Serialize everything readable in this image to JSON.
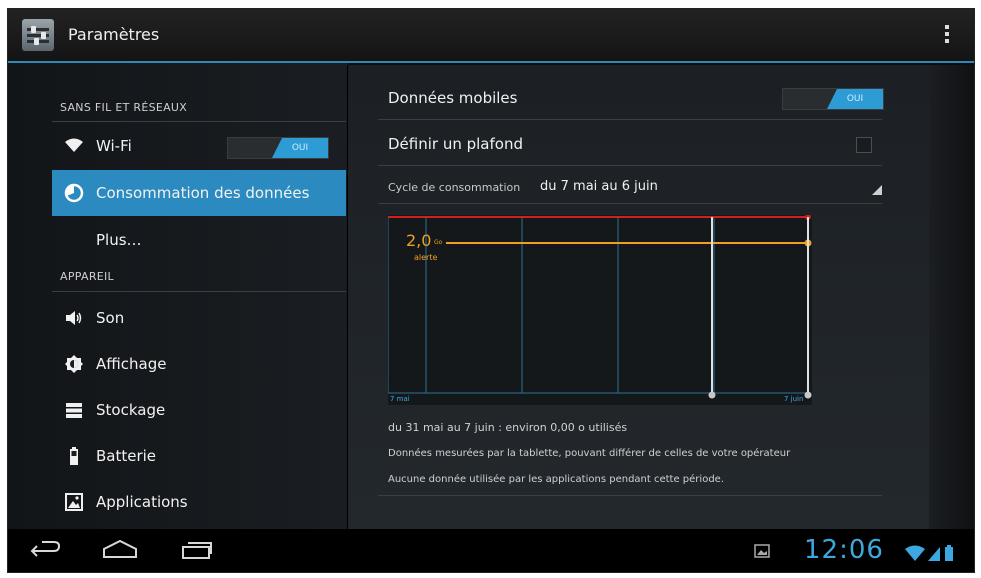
{
  "action_bar": {
    "title": "Paramètres",
    "icon": "settings-sliders-icon",
    "overflow_icon": "overflow-menu-icon"
  },
  "sidebar": {
    "section1": "SANS FIL ET RÉSEAUX",
    "section2": "APPAREIL",
    "items": [
      {
        "label": "Wi-Fi",
        "icon": "wifi-icon",
        "toggle": "OUI"
      },
      {
        "label": "Consommation des données",
        "icon": "data-usage-icon",
        "selected": true
      },
      {
        "label": "Plus…",
        "icon": ""
      },
      {
        "label": "Son",
        "icon": "speaker-icon"
      },
      {
        "label": "Affichage",
        "icon": "brightness-icon"
      },
      {
        "label": "Stockage",
        "icon": "storage-icon"
      },
      {
        "label": "Batterie",
        "icon": "battery-icon"
      },
      {
        "label": "Applications",
        "icon": "applications-icon"
      }
    ]
  },
  "detail": {
    "mobile_data_label": "Données mobiles",
    "mobile_data_toggle": "OUI",
    "limit_label": "Définir un plafond",
    "cycle_label": "Cycle de consommation",
    "cycle_value": "du 7 mai au 6 juin",
    "chart": {
      "warning_value": "2,0",
      "warning_unit": "Go",
      "warning_label": "alerte",
      "start_label": "7 mai",
      "end_label": "7 juin"
    },
    "usage_summary": "du 31 mai au 7 juin : environ 0,00 o utilisés",
    "note1": "Données mesurées par la tablette, pouvant différer de celles de votre opérateur",
    "note2": "Aucune donnée utilisée par les applications pendant cette période."
  },
  "nav_bar": {
    "back_icon": "back-icon",
    "home_icon": "home-icon",
    "recents_icon": "recent-apps-icon",
    "clock": "12:06"
  },
  "colors": {
    "accent": "#2b8bc0",
    "warning": "#f0a020",
    "limit": "#d02020",
    "clock": "#3da8df"
  }
}
